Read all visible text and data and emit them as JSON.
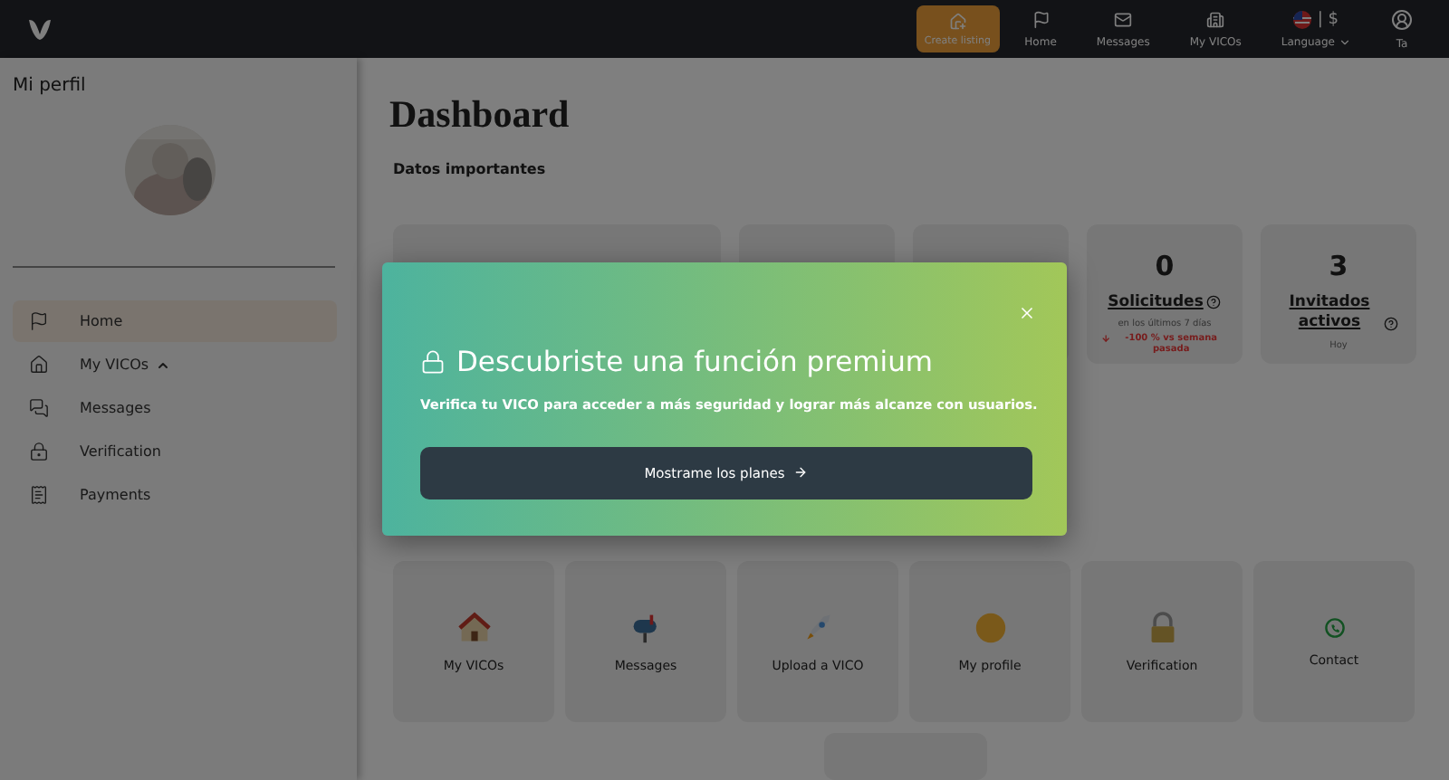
{
  "top_bar": {
    "create_button": "Create listing",
    "nav": [
      {
        "label": "Home",
        "kind": "flag"
      },
      {
        "label": "Messages",
        "kind": "mail"
      },
      {
        "label": "My VICOs",
        "kind": "buildings"
      }
    ],
    "language": {
      "label": "Language",
      "currency": "| $"
    },
    "user": "Ta"
  },
  "sidebar": {
    "title": "Mi perfil",
    "items": [
      {
        "label": "Home",
        "kind": "flag",
        "selected": true
      },
      {
        "label": "My VICOs",
        "kind": "house",
        "selected": false,
        "expanded": true
      },
      {
        "label": "Messages",
        "kind": "chat",
        "selected": false
      },
      {
        "label": "Verification",
        "kind": "lock",
        "selected": false
      },
      {
        "label": "Payments",
        "kind": "receipt",
        "selected": false
      }
    ]
  },
  "dashboard": {
    "title": "Dashboard",
    "subtitle": "Datos importantes",
    "stats": [
      {
        "kind": "blank"
      },
      {
        "kind": "blank"
      },
      {
        "kind": "blank"
      },
      {
        "kind": "metric",
        "value": "0",
        "label": "Solicitudes",
        "note": "en los últimos 7 días",
        "change": "-100 % vs semana pasada",
        "decreasing": true
      },
      {
        "kind": "metric",
        "value": "3",
        "label": "Invitados activos",
        "note": "Hoy"
      }
    ],
    "shortcuts": [
      {
        "label": "My VICOs",
        "kind": "house"
      },
      {
        "label": "Messages",
        "kind": "mailbox"
      },
      {
        "label": "Upload a VICO",
        "kind": "rocket"
      },
      {
        "label": "My profile",
        "kind": "smiley"
      },
      {
        "label": "Verification",
        "kind": "padlock"
      },
      {
        "label": "Contact",
        "kind": "phone"
      }
    ]
  },
  "modal": {
    "title": "Descubriste una función premium",
    "text": "Verifica tu VICO para acceder a más seguridad y lograr más alcanze con usuarios.",
    "button": "Mostrame los planes"
  }
}
